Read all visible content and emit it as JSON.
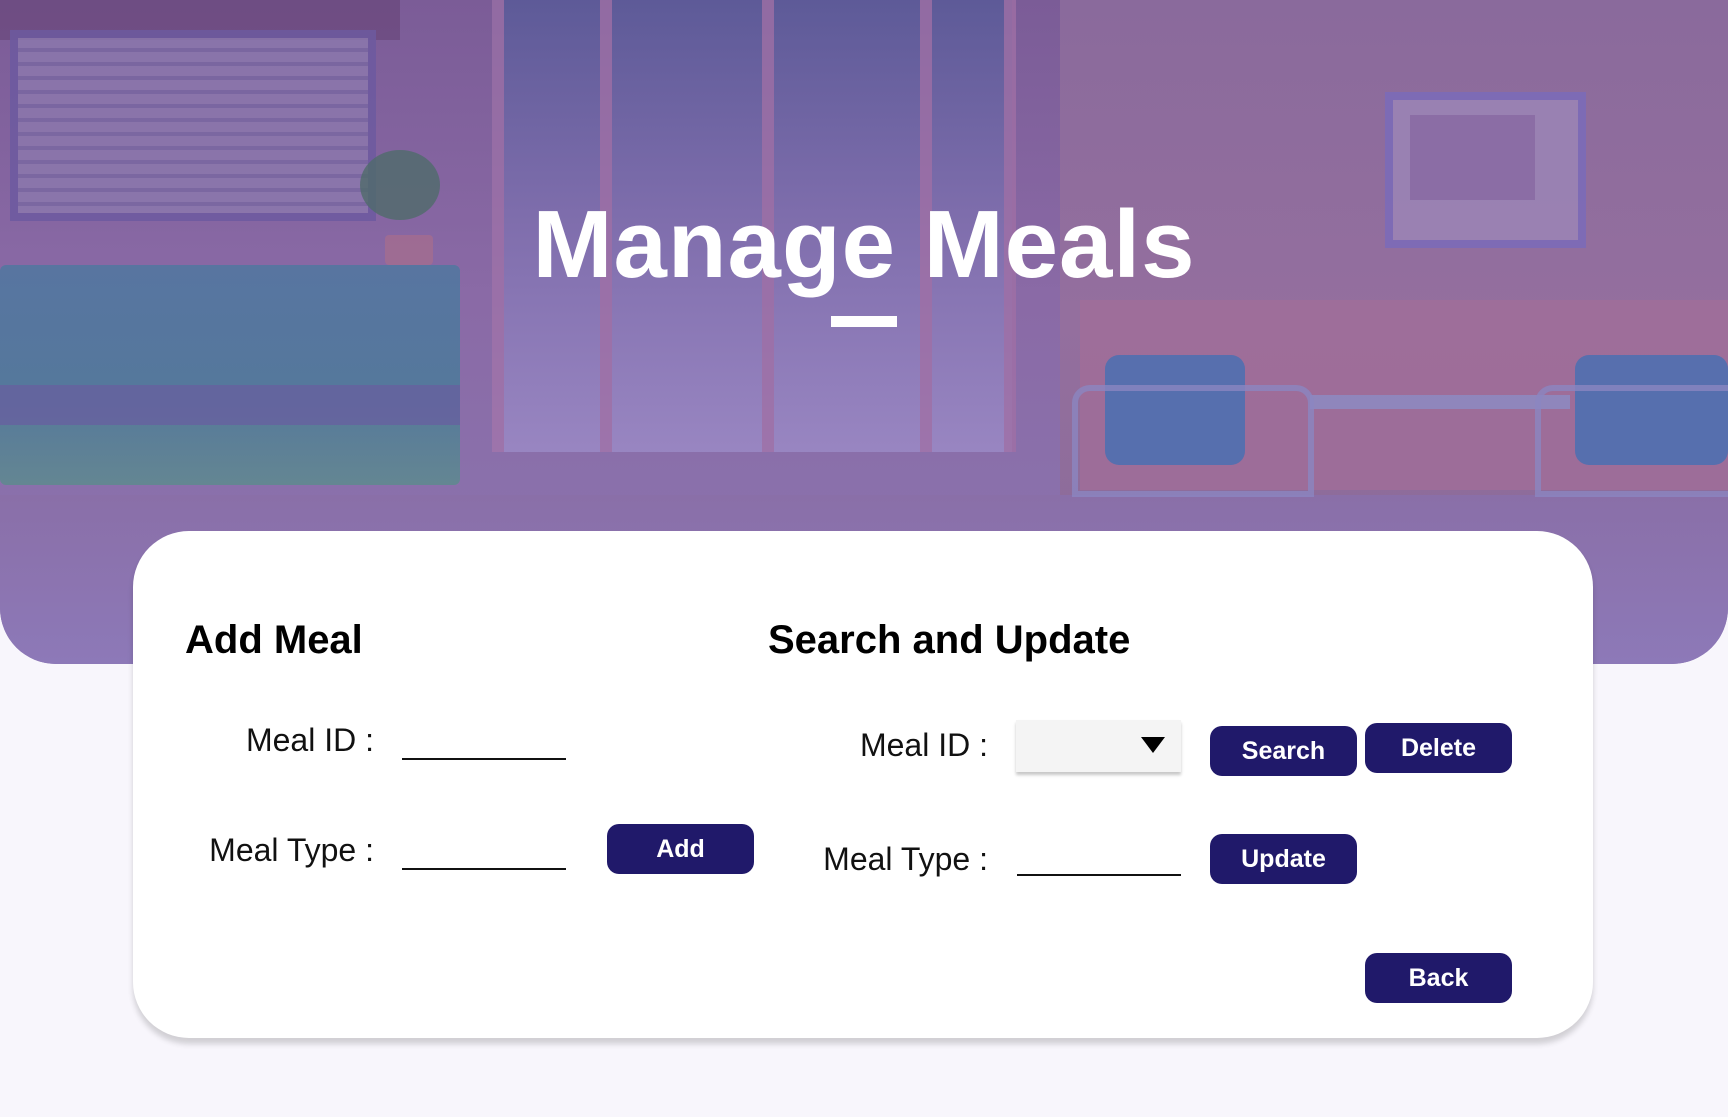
{
  "page": {
    "title": "Manage Meals",
    "accent_color": "#20196a"
  },
  "add_meal": {
    "heading": "Add Meal",
    "meal_id_label": "Meal ID :",
    "meal_id_value": "",
    "meal_type_label": "Meal Type :",
    "meal_type_value": "",
    "add_button": "Add"
  },
  "search_update": {
    "heading": "Search and Update",
    "meal_id_label": "Meal ID :",
    "meal_id_selected": "",
    "meal_type_label": "Meal Type :",
    "meal_type_value": "",
    "search_button": "Search",
    "delete_button": "Delete",
    "update_button": "Update",
    "dropdown_icon": "caret-down-icon"
  },
  "footer": {
    "back_button": "Back"
  }
}
